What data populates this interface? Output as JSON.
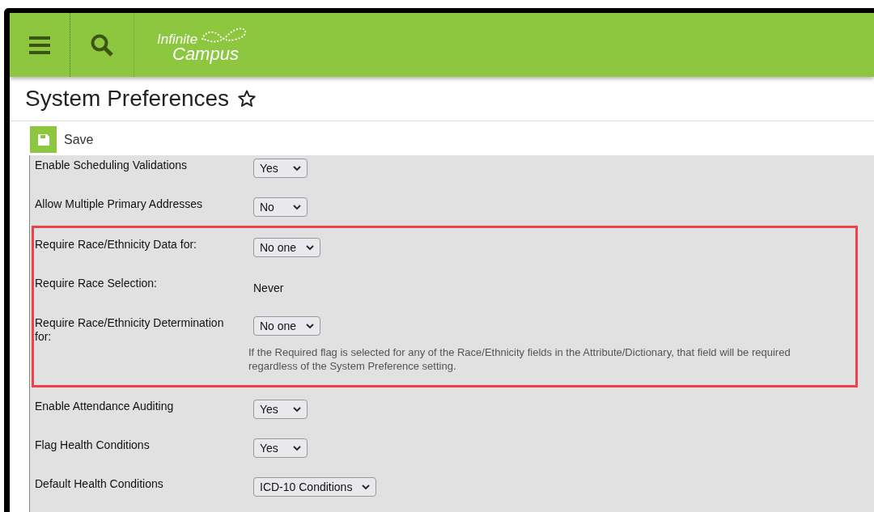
{
  "header": {
    "logo_line_1": "Infinite",
    "logo_line_2": "Campus"
  },
  "page": {
    "title": "System Preferences",
    "favorite": false
  },
  "toolbar": {
    "save_label": "Save"
  },
  "sections": [
    {
      "kind": "plain",
      "rows": [
        {
          "kind": "select",
          "label": "Enable Scheduling Validations",
          "value": "Yes"
        },
        {
          "kind": "select",
          "label": "Allow Multiple Primary Addresses",
          "value": "No"
        }
      ]
    },
    {
      "kind": "highlighted",
      "rows": [
        {
          "kind": "select",
          "label": "Require Race/Ethnicity Data for:",
          "value": "No one"
        },
        {
          "kind": "text",
          "label": "Require Race Selection:",
          "value": "Never"
        },
        {
          "kind": "select",
          "label": "Require Race/Ethnicity Determination for:",
          "value": "No one",
          "note": "If the Required flag is selected for any of the Race/Ethnicity fields in the Attribute/Dictionary, that field will be required regardless of the System Preference setting."
        }
      ]
    },
    {
      "kind": "plain",
      "rows": [
        {
          "kind": "select",
          "label": "Enable Attendance Auditing",
          "value": "Yes"
        },
        {
          "kind": "select",
          "label": "Flag Health Conditions",
          "value": "Yes"
        },
        {
          "kind": "select",
          "label": "Default Health Conditions",
          "value": "ICD-10 Conditions"
        }
      ]
    }
  ]
}
